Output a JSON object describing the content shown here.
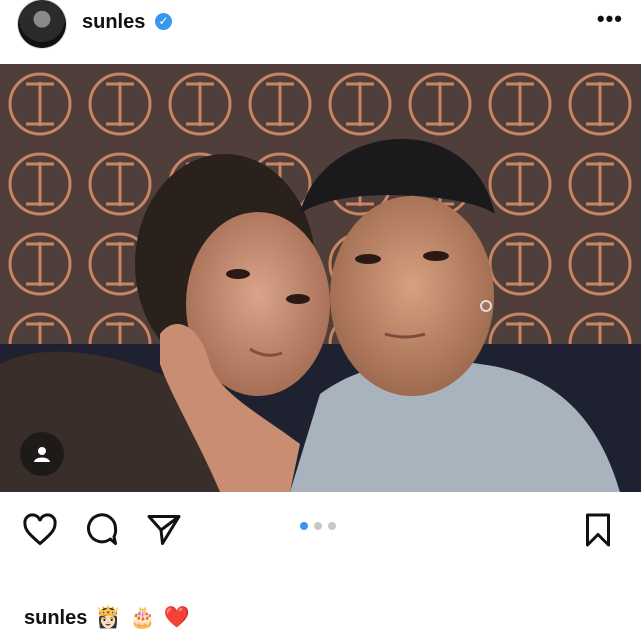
{
  "post": {
    "username": "sunles",
    "verified_mark": "✓",
    "more_label": "•••",
    "photo_description_icon": "person-tag-icon",
    "carousel": {
      "count": 3,
      "active_index": 0
    },
    "caption_emojis": [
      "👸🏻",
      "🎂",
      "❤️"
    ]
  },
  "icons": {
    "like": "heart-icon",
    "comment": "comment-bubble-icon",
    "share": "paper-plane-icon",
    "save": "bookmark-icon",
    "more": "more-dots-icon"
  },
  "colors": {
    "verified": "#3897f0",
    "active_dot": "#3897f0",
    "inactive_dot": "#c7c7c7",
    "wallpaper": "#4a3a36",
    "pattern": "#c98563"
  }
}
